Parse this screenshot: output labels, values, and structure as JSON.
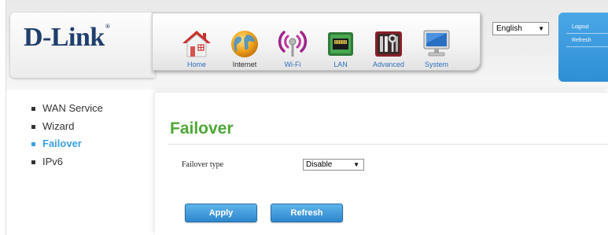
{
  "brand": {
    "name": "D-Link",
    "registered_mark": "®"
  },
  "nav": {
    "active": "Internet",
    "items": [
      {
        "label": "Home",
        "icon": "home-icon"
      },
      {
        "label": "Internet",
        "icon": "globe-icon"
      },
      {
        "label": "Wi-Fi",
        "icon": "wifi-icon"
      },
      {
        "label": "LAN",
        "icon": "lan-port-icon"
      },
      {
        "label": "Advanced",
        "icon": "tools-icon"
      },
      {
        "label": "System",
        "icon": "monitor-icon"
      }
    ]
  },
  "language": {
    "selected": "English"
  },
  "account": {
    "logout_label": "Logout",
    "refresh_label": "Refresh"
  },
  "sidebar": {
    "items": [
      {
        "label": "WAN Service",
        "active": false
      },
      {
        "label": "Wizard",
        "active": false
      },
      {
        "label": "Failover",
        "active": true
      },
      {
        "label": "IPv6",
        "active": false
      }
    ]
  },
  "main": {
    "title": "Failover",
    "failover_type": {
      "label": "Failover type",
      "value": "Disable"
    },
    "apply_label": "Apply",
    "refresh_label": "Refresh"
  },
  "colors": {
    "brand_navy": "#1f3e6d",
    "accent_blue": "#3aa0e0",
    "title_green": "#4ea838",
    "button_blue": "#2d86cc",
    "nav_label_blue": "#2f6fbf"
  }
}
